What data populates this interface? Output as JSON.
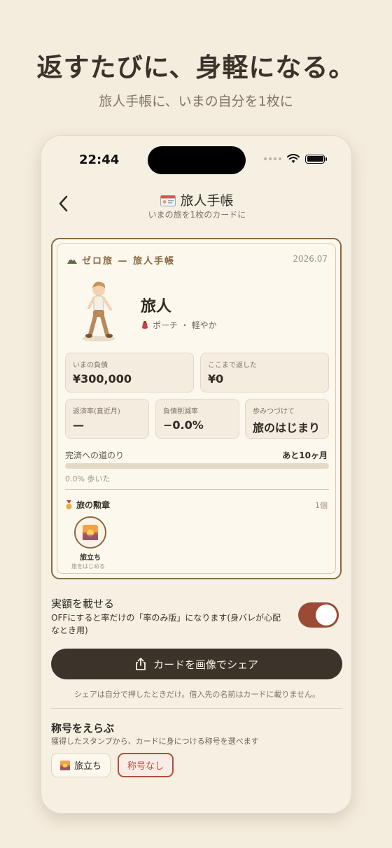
{
  "promo": {
    "headline": "返すたびに、身軽になる。",
    "subline": "旅人手帳に、いまの自分を1枚に"
  },
  "status_bar": {
    "time": "22:44"
  },
  "nav": {
    "back_icon": "chevron-left-icon",
    "title": "旅人手帳",
    "subtitle": "いまの旅を1枚のカードに"
  },
  "card": {
    "brand": "ゼロ旅 — 旅人手帳",
    "date": "2026.07",
    "hero_name": "旅人",
    "hero_item": "ポーチ ・ 軽やか",
    "stats": [
      {
        "label": "いまの負債",
        "value": "¥300,000"
      },
      {
        "label": "ここまで返した",
        "value": "¥0"
      },
      {
        "label": "返済率(直近月)",
        "value": "—"
      },
      {
        "label": "負債削減率",
        "value": "−0.0%"
      },
      {
        "label": "歩みつづけて",
        "value": "旅のはじまり"
      }
    ],
    "progress": {
      "label": "完済への道のり",
      "remaining": "あと10ヶ月",
      "fraction": 0.0,
      "caption": "0.0% 歩いた"
    },
    "medals": {
      "title": "旅の勲章",
      "count": "1個",
      "items": [
        {
          "name": "旅立ち",
          "sub": "旅をはじめる"
        }
      ]
    }
  },
  "amount_toggle": {
    "title": "実額を載せる",
    "description": "OFFにすると率だけの「率のみ版」になります(身バレが心配なとき用)",
    "on": true
  },
  "share": {
    "button_label": "カードを画像でシェア",
    "note": "シェアは自分で押したときだけ。借入先の名前はカードに載りません。"
  },
  "title_select": {
    "title": "称号をえらぶ",
    "description": "獲得したスタンプから、カードに身につける称号を選べます",
    "options": [
      {
        "label": "旅立ち"
      },
      {
        "label": "称号なし"
      }
    ]
  },
  "colors": {
    "accent": "#8a6a42",
    "toggle_on": "#9a4a35",
    "selected": "#b24f3f",
    "button": "#3b342a"
  }
}
